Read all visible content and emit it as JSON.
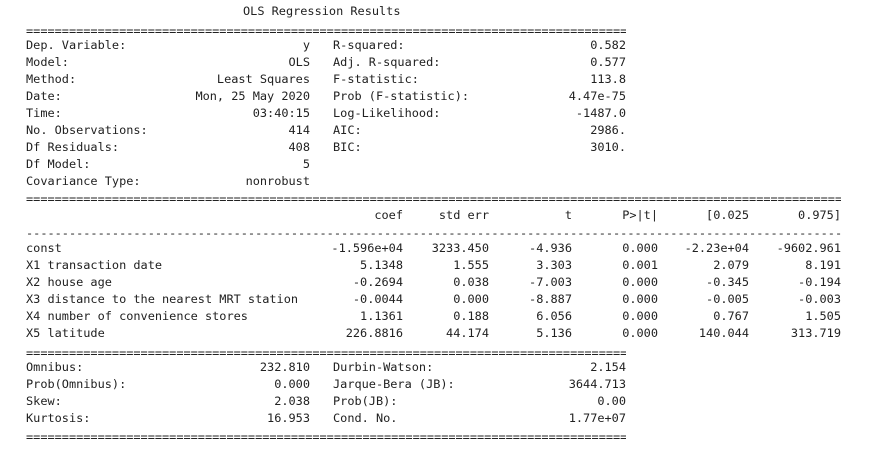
{
  "title": "OLS Regression Results",
  "top_left": [
    {
      "label": "Dep. Variable:",
      "value": "y"
    },
    {
      "label": "Model:",
      "value": "OLS"
    },
    {
      "label": "Method:",
      "value": "Least Squares"
    },
    {
      "label": "Date:",
      "value": "Mon, 25 May 2020"
    },
    {
      "label": "Time:",
      "value": "03:40:15"
    },
    {
      "label": "No. Observations:",
      "value": "414"
    },
    {
      "label": "Df Residuals:",
      "value": "408"
    },
    {
      "label": "Df Model:",
      "value": "5"
    },
    {
      "label": "Covariance Type:",
      "value": "nonrobust"
    }
  ],
  "top_right": [
    {
      "label": "R-squared:",
      "value": "0.582"
    },
    {
      "label": "Adj. R-squared:",
      "value": "0.577"
    },
    {
      "label": "F-statistic:",
      "value": "113.8"
    },
    {
      "label": "Prob (F-statistic):",
      "value": "4.47e-75"
    },
    {
      "label": "Log-Likelihood:",
      "value": "-1487.0"
    },
    {
      "label": "AIC:",
      "value": "2986."
    },
    {
      "label": "BIC:",
      "value": "3010."
    }
  ],
  "coef_headers": [
    "coef",
    "std err",
    "t",
    "P>|t|",
    "[0.025",
    "0.975]"
  ],
  "coef_rows": [
    {
      "name": "const",
      "cells": [
        "-1.596e+04",
        "3233.450",
        "-4.936",
        "0.000",
        "-2.23e+04",
        "-9602.961"
      ]
    },
    {
      "name": "X1 transaction date",
      "cells": [
        "5.1348",
        "1.555",
        "3.303",
        "0.001",
        "2.079",
        "8.191"
      ]
    },
    {
      "name": "X2 house age",
      "cells": [
        "-0.2694",
        "0.038",
        "-7.003",
        "0.000",
        "-0.345",
        "-0.194"
      ]
    },
    {
      "name": "X3 distance to the nearest MRT station",
      "cells": [
        "-0.0044",
        "0.000",
        "-8.887",
        "0.000",
        "-0.005",
        "-0.003"
      ]
    },
    {
      "name": "X4 number of convenience stores",
      "cells": [
        "1.1361",
        "0.188",
        "6.056",
        "0.000",
        "0.767",
        "1.505"
      ]
    },
    {
      "name": "X5 latitude",
      "cells": [
        "226.8816",
        "44.174",
        "5.136",
        "0.000",
        "140.044",
        "313.719"
      ]
    }
  ],
  "bottom_left": [
    {
      "label": "Omnibus:",
      "value": "232.810"
    },
    {
      "label": "Prob(Omnibus):",
      "value": "0.000"
    },
    {
      "label": "Skew:",
      "value": "2.038"
    },
    {
      "label": "Kurtosis:",
      "value": "16.953"
    }
  ],
  "bottom_right": [
    {
      "label": "Durbin-Watson:",
      "value": "2.154"
    },
    {
      "label": "Jarque-Bera (JB):",
      "value": "3644.713"
    },
    {
      "label": "Prob(JB):",
      "value": "0.00"
    },
    {
      "label": "Cond. No.",
      "value": "1.77e+07"
    }
  ],
  "separators": {
    "double": "==============================================================================================================================================",
    "single": "----------------------------------------------------------------------------------------------------------------------------------------------"
  }
}
